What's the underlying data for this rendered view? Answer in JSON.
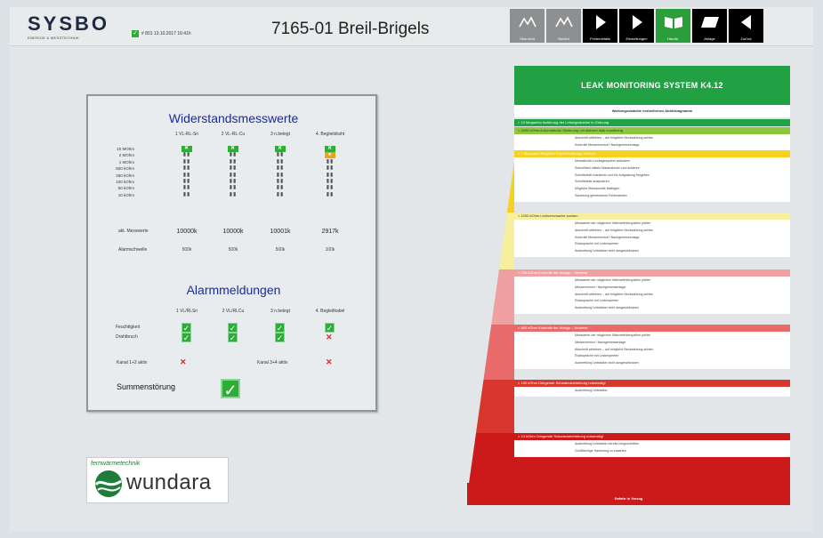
{
  "header": {
    "logo": "SYSBO",
    "logo_sub": "ENERGIE & MESSTECHNIK",
    "status_text": "# 801  13.10.2017  16:41h",
    "station": "7165-01 Breil-Brigels",
    "nav": [
      {
        "label": "Übersicht",
        "icon": "chart-icon",
        "style": "gray"
      },
      {
        "label": "Bericht",
        "icon": "chart-icon",
        "style": "gray"
      },
      {
        "label": "Fehlerdetails",
        "icon": "arrow-right-icon",
        "style": "black"
      },
      {
        "label": "Einstellungen",
        "icon": "arrow-right-icon",
        "style": "black"
      },
      {
        "label": "Handb.",
        "icon": "book-icon",
        "style": "green"
      },
      {
        "label": "Ablage",
        "icon": "folder-icon",
        "style": "black"
      },
      {
        "label": "Zurück",
        "icon": "arrow-left-icon",
        "style": "black"
      }
    ]
  },
  "measurements": {
    "title": "Widerstandsmesswerte",
    "columns": [
      "1 VL-RL-Sn",
      "2 VL-RL-Cu",
      "3 n.belegt",
      "4. Begleitdraht"
    ],
    "rows": [
      "10 MOhm",
      "2 MOhm",
      "1 MOhm",
      "500 kOhm",
      "250 kOhm",
      "100 kOhm",
      "50 kOhm",
      "10 kOhm"
    ],
    "current_label": "akt. Messwerte",
    "current_values": [
      "10000k",
      "10000k",
      "10001k",
      "2917k"
    ],
    "threshold_label": "Alarmschwelle",
    "threshold_values": [
      "500k",
      "500k",
      "500k",
      "100k"
    ]
  },
  "alarms": {
    "title": "Alarmmeldungen",
    "columns": [
      "1 VL/RLSn",
      "2 VL/RLCu",
      "3 n.belegt",
      "4. Begleitkabel"
    ],
    "row_moisture": "Feuchtigkeit",
    "row_break": "Drahtbruch",
    "channel12": "Kanal 1+2 aktiv",
    "channel34": "Kanal 3+4 aktiv",
    "summary": "Summenstörung"
  },
  "wundara": {
    "tagline": "fernwärmetechnik",
    "name": "wundara"
  },
  "leak": {
    "title": "LEAK MONITORING SYSTEM K4.12",
    "subtitle": "Wartungsstabelle vorbeifornes Abhilzbagnamm",
    "levels": [
      {
        "color": "#21a244",
        "bar": "> 10 Megaohm   Isolierung der Leitungsstrecke in Ordnung",
        "items": []
      },
      {
        "color": "#8dc63f",
        "bar": "< 2000 kOhm   Automatische Sicherung mit aktiviert leak monitoring",
        "items": [
          "Abschnitt abfahren – auf mögliche Beobachtung achten",
          "Kontrolle Messerventuri / Nachgemessenlage"
        ]
      },
      {
        "color": "#f7d11e",
        "bar": "< 1 Megaohm   Mögliche Durchfeuchtung / Welken",
        "items": [
          "Messstichler Leckagesystem anfordern",
          "Schnelltest mittels Massnahmen und anderen",
          "Schnittstelle markieren und für Aufgrabung freigeben",
          "Schnittstelle analysieren",
          "Mögliche Messpunkte festlegen",
          "Sanierung gemessener Fehlerstellen"
        ]
      },
      {
        "color": "#f8ef9c",
        "bar": "< 1000 kOhm   Leckverursache suchen",
        "items": [
          "Messwerte der möglichen Wärmefehlerquellen prüfen",
          "Abschnitt abfahren – auf mögliche Beobachtung achten",
          "Kontrolle Messerventuri / Nachgemessenlage",
          "Rücksprache mit Leckexperten",
          "Ausbreitung Leitstation nicht ausgeschlossen"
        ]
      },
      {
        "color": "#f0a0a0",
        "bar": "< 750 kOhm   Kontrolle der Anlage – Hinweis!",
        "items": [
          "Messwerte der möglichen Wärmefehlerquellen prüfen",
          "Messerventuri / Nachgemessenlage",
          "Abschnitt abfahren – auf mögliche Beobachtung achten",
          "Rücksprache mit Leckexperten",
          "Ausbreitung Leitstation nicht ausgeschlossen"
        ]
      },
      {
        "color": "#e86a6a",
        "bar": "< 500 kOhm   Kontrolle der Anlage – Hinweis!",
        "items": [
          "Messwerte der möglichen Wärmefehlerquellen prüfen",
          "Messerventuri / Nachgemessenlage",
          "Abschnitt abfahren – auf mögliche Beobachtung achten",
          "Rücksprache mit Leckexperten",
          "Ausbreitung Leitstation nicht ausgeschlossen"
        ]
      },
      {
        "color": "#d9362e",
        "bar": "< 100 kOhm   Dringende Schadensbehebung notwendig!",
        "items": [
          "Ausbreitung Leitstation"
        ]
      },
      {
        "color": "#cc1a1a",
        "bar": "< 10 kOhm   Dringende Schadensbehebung notwendig!",
        "items": [
          "Ausbreitung Leitstation bereits fortgeschritten",
          "Großflächige Sanierung zu erwarten"
        ]
      }
    ],
    "footer": "Gefahr in Verzug"
  }
}
